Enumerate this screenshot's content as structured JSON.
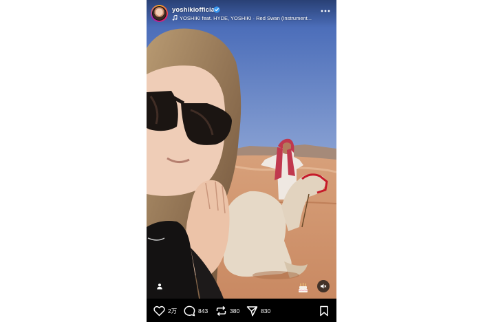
{
  "header": {
    "username": "yoshikiofficial",
    "verified": true,
    "music_text": "YOSHIKI feat. HYDE, YOSHIKI · Red Swan (Instrument..."
  },
  "icons": {
    "avatar": "profile-avatar",
    "verified": "verified-badge-icon",
    "music": "music-note-icon",
    "more": "more-dots-icon",
    "tagged": "person-icon",
    "sticker": "birthday-cake-icon",
    "mute": "speaker-muted-icon",
    "like": "heart-icon",
    "comment": "comment-icon",
    "repost": "repost-icon",
    "share": "send-icon",
    "save": "bookmark-icon"
  },
  "actions": {
    "likes": "2万",
    "comments": "843",
    "reposts": "380",
    "shares": "830"
  },
  "colors": {
    "verified": "#3897f0",
    "bar_bg": "#000000",
    "text": "#ffffff"
  }
}
